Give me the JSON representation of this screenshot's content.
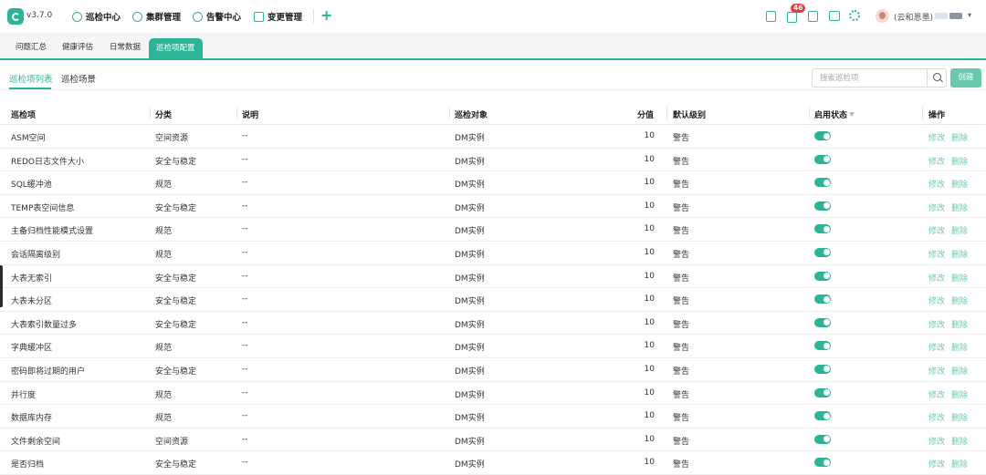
{
  "app": {
    "version": "v3.7.0",
    "nav": [
      "巡检中心",
      "集群管理",
      "告警中心",
      "变更管理"
    ],
    "add_symbol": "+",
    "notification_count": "46",
    "user_name": "(云和恩墨)"
  },
  "sub_tabs": [
    "问题汇总",
    "健康评估",
    "日常数据",
    "巡检项配置"
  ],
  "page_tabs": [
    "巡检项列表",
    "巡检场景"
  ],
  "search": {
    "placeholder": "搜索巡检项"
  },
  "create_label": "创建",
  "table": {
    "headers": [
      "巡检项",
      "分类",
      "说明",
      "巡检对象",
      "分值",
      "默认级别",
      "启用状态",
      "操作"
    ],
    "actions": {
      "edit": "修改",
      "delete": "删除"
    },
    "rows": [
      [
        "ASM空间",
        "空间资源",
        "--",
        "DM实例",
        "10",
        "警告"
      ],
      [
        "REDO日志文件大小",
        "安全与稳定",
        "--",
        "DM实例",
        "10",
        "警告"
      ],
      [
        "SQL缓冲池",
        "规范",
        "--",
        "DM实例",
        "10",
        "警告"
      ],
      [
        "TEMP表空间信息",
        "安全与稳定",
        "--",
        "DM实例",
        "10",
        "警告"
      ],
      [
        "主备归档性能模式设置",
        "规范",
        "--",
        "DM实例",
        "10",
        "警告"
      ],
      [
        "会话隔离级别",
        "规范",
        "--",
        "DM实例",
        "10",
        "警告"
      ],
      [
        "大表无索引",
        "安全与稳定",
        "--",
        "DM实例",
        "10",
        "警告"
      ],
      [
        "大表未分区",
        "安全与稳定",
        "--",
        "DM实例",
        "10",
        "警告"
      ],
      [
        "大表索引数量过多",
        "安全与稳定",
        "--",
        "DM实例",
        "10",
        "警告"
      ],
      [
        "字典缓冲区",
        "规范",
        "--",
        "DM实例",
        "10",
        "警告"
      ],
      [
        "密码即将过期的用户",
        "安全与稳定",
        "--",
        "DM实例",
        "10",
        "警告"
      ],
      [
        "并行度",
        "规范",
        "--",
        "DM实例",
        "10",
        "警告"
      ],
      [
        "数据库内存",
        "规范",
        "--",
        "DM实例",
        "10",
        "警告"
      ],
      [
        "文件剩余空间",
        "空间资源",
        "--",
        "DM实例",
        "10",
        "警告"
      ],
      [
        "是否归档",
        "安全与稳定",
        "--",
        "DM实例",
        "10",
        "警告"
      ]
    ]
  }
}
